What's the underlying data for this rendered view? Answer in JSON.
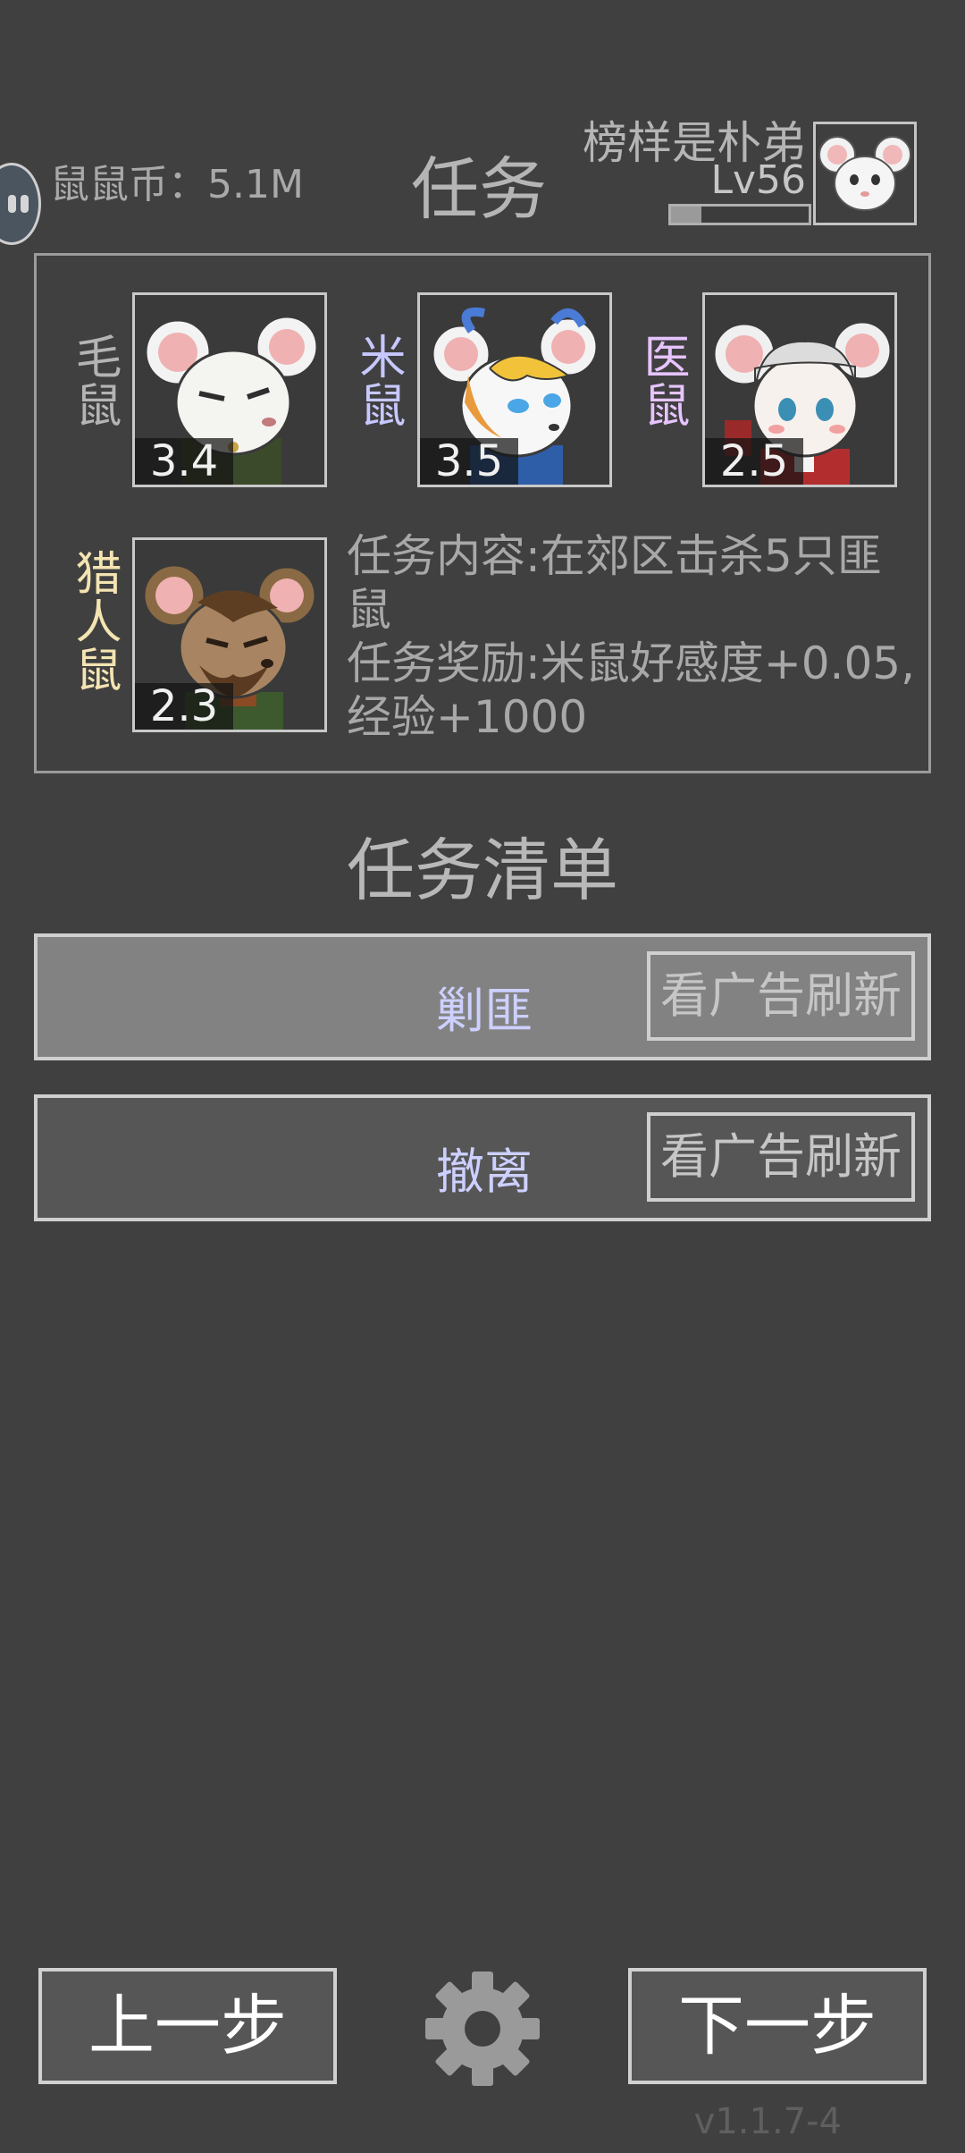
{
  "header": {
    "coins_label": "鼠鼠币：5.1M",
    "title": "任务",
    "player_name": "榜样是朴弟",
    "player_level": "Lv56",
    "xp_progress": 0.22
  },
  "characters": [
    {
      "name": "毛鼠",
      "favor": "3.4",
      "name_color": "#b4b4b4",
      "icon": "white-mouse-portrait"
    },
    {
      "name": "米鼠",
      "favor": "3.5",
      "name_color": "#c7c8ff",
      "icon": "blond-mouse-portrait"
    },
    {
      "name": "医鼠",
      "favor": "2.5",
      "name_color": "#e7c4ff",
      "icon": "nurse-mouse-portrait"
    },
    {
      "name": "猎人鼠",
      "favor": "2.3",
      "name_color": "#f4e4b2",
      "icon": "hunter-mouse-portrait"
    }
  ],
  "task": {
    "content": "任务内容:在郊区击杀5只匪鼠",
    "reward": "任务奖励:米鼠好感度+0.05,经验+1000"
  },
  "task_list": {
    "title": "任务清单",
    "items": [
      {
        "name": "剿匪",
        "refresh_label": "看广告刷新",
        "selected": true
      },
      {
        "name": "撤离",
        "refresh_label": "看广告刷新",
        "selected": false
      }
    ]
  },
  "nav": {
    "prev_label": "上一步",
    "next_label": "下一步"
  },
  "version": "v1.1.7-4",
  "colors": {
    "background": "#404040",
    "selected_row": "#828282",
    "unselected_row": "#565656",
    "accent_text": "#cdd0ff"
  }
}
